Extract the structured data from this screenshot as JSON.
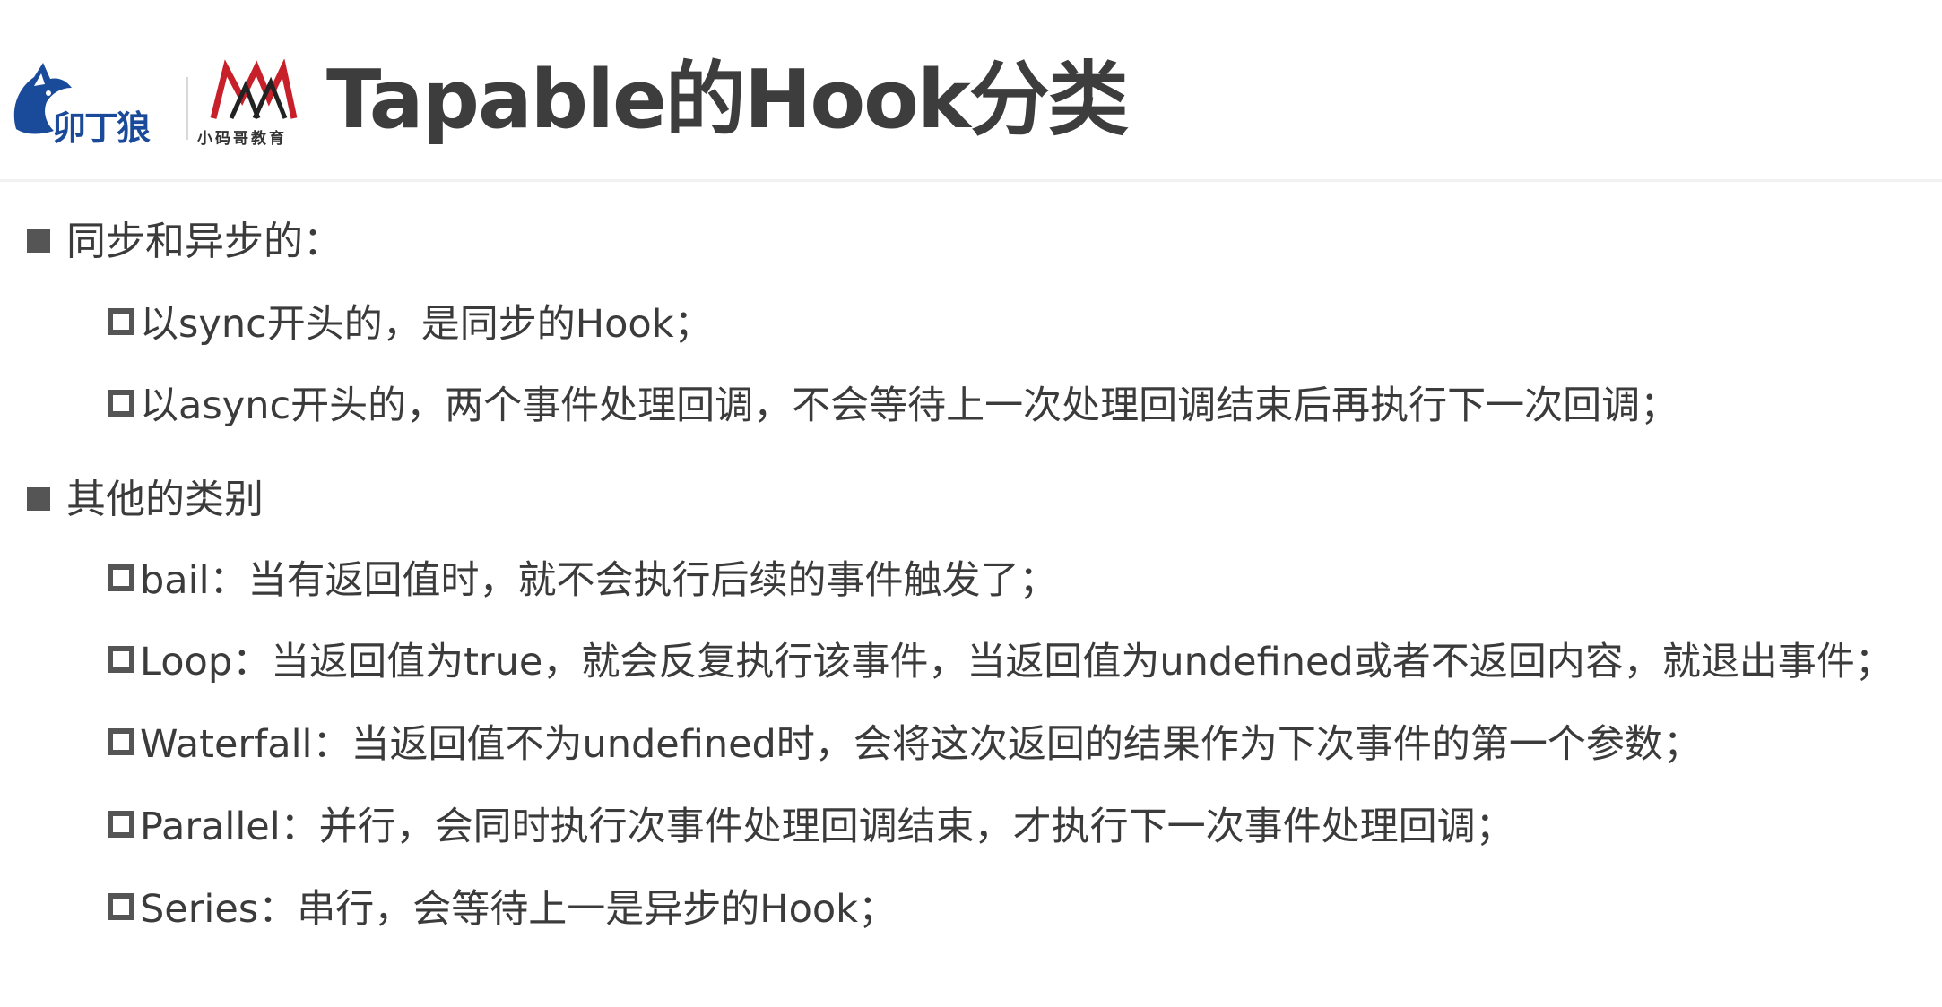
{
  "header": {
    "logo_left_text": "卯丁狼",
    "logo_right_text": "小码哥教育",
    "title": "Tapable的Hook分类"
  },
  "sections": [
    {
      "heading": "同步和异步的：",
      "items": [
        "以sync开头的，是同步的Hook；",
        "以async开头的，两个事件处理回调，不会等待上一次处理回调结束后再执行下一次回调；"
      ]
    },
    {
      "heading": "其他的类别",
      "items": [
        "bail：当有返回值时，就不会执行后续的事件触发了；",
        "Loop：当返回值为true，就会反复执行该事件，当返回值为undefined或者不返回内容，就退出事件；",
        "Waterfall：当返回值不为undefined时，会将这次返回的结果作为下次事件的第一个参数；",
        "Parallel：并行，会同时执行次事件处理回调结束，才执行下一次事件处理回调；",
        "Series：串行，会等待上一是异步的Hook；"
      ]
    }
  ],
  "colors": {
    "text": "#3b3b3b",
    "bullet": "#555555",
    "logo_blue": "#1a4a9a",
    "logo_red": "#c8202a"
  }
}
